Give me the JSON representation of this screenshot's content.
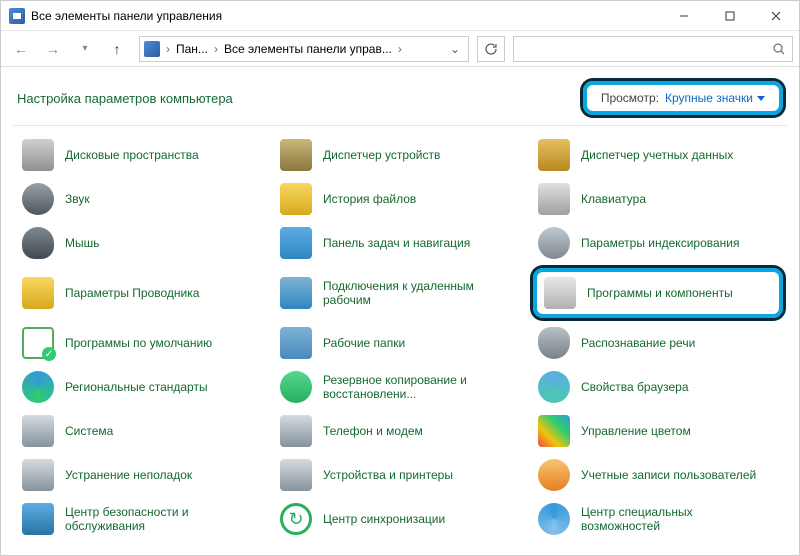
{
  "titlebar": {
    "title": "Все элементы панели управления"
  },
  "breadcrumb": {
    "root": "Пан...",
    "current": "Все элементы панели управ..."
  },
  "heading": "Настройка параметров компьютера",
  "view": {
    "label": "Просмотр:",
    "value": "Крупные значки"
  },
  "items": [
    {
      "label": "Дисковые пространства",
      "icon": "disk"
    },
    {
      "label": "Диспетчер устройств",
      "icon": "dev"
    },
    {
      "label": "Диспетчер учетных данных",
      "icon": "cred"
    },
    {
      "label": "Звук",
      "icon": "sound"
    },
    {
      "label": "История файлов",
      "icon": "filehist"
    },
    {
      "label": "Клавиатура",
      "icon": "kbd"
    },
    {
      "label": "Мышь",
      "icon": "mouse"
    },
    {
      "label": "Панель задач и навигация",
      "icon": "task"
    },
    {
      "label": "Параметры индексирования",
      "icon": "index"
    },
    {
      "label": "Параметры Проводника",
      "icon": "explorer"
    },
    {
      "label": "Подключения к удаленным рабочим",
      "icon": "remote"
    },
    {
      "label": "Программы и компоненты",
      "icon": "progs",
      "highlighted": true
    },
    {
      "label": "Программы по умолчанию",
      "icon": "default"
    },
    {
      "label": "Рабочие папки",
      "icon": "work"
    },
    {
      "label": "Распознавание речи",
      "icon": "speech"
    },
    {
      "label": "Региональные стандарты",
      "icon": "region"
    },
    {
      "label": "Резервное копирование и восстановлени...",
      "icon": "backup"
    },
    {
      "label": "Свойства браузера",
      "icon": "browser"
    },
    {
      "label": "Система",
      "icon": "system"
    },
    {
      "label": "Телефон и модем",
      "icon": "phone"
    },
    {
      "label": "Управление цветом",
      "icon": "color"
    },
    {
      "label": "Устранение неполадок",
      "icon": "trouble"
    },
    {
      "label": "Устройства и принтеры",
      "icon": "printer"
    },
    {
      "label": "Учетные записи пользователей",
      "icon": "users"
    },
    {
      "label": "Центр безопасности и обслуживания",
      "icon": "security"
    },
    {
      "label": "Центр синхронизации",
      "icon": "sync"
    },
    {
      "label": "Центр специальных возможностей",
      "icon": "access"
    }
  ]
}
